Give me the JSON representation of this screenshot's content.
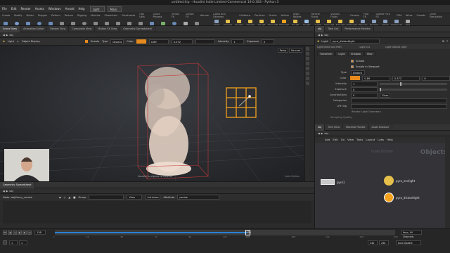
{
  "window": {
    "title": "untitled.hip - Houdini Indie Limited-Commercial 19.0.383 - Python 3"
  },
  "menu": {
    "items": [
      "File",
      "Edit",
      "Render",
      "Assets",
      "Windows",
      "Arnold",
      "Help"
    ],
    "desktop": "Light",
    "build_label": "Main"
  },
  "shelf": {
    "tabs": [
      "Create",
      "Modify",
      "Model",
      "Polygon",
      "Deform",
      "Texture",
      "Rigging",
      "Muscles",
      "Characters",
      "Constraints",
      "Hair Utils",
      "Guide Process",
      "Terrain FX",
      "Simple FX",
      "Volume"
    ],
    "right_tabs": [
      "Lights and Cameras",
      "Collisions",
      "Particles",
      "Grains",
      "Vellum",
      "Rigid Bodies",
      "Particle Fluids",
      "Viscous Fluids",
      "Oceans",
      "Pyro FX",
      "Sparse Pyro FX",
      "FEM",
      "Wires",
      "Crowds",
      "Drive Simulation"
    ],
    "tools": [
      "Camera",
      "Point Light",
      "Spot Light",
      "Area Light",
      "Geo Light",
      "Volume Light",
      "Distant Light",
      "Env Light",
      "Sky Light",
      "GI Light",
      "Caustic Light",
      "Portal Light",
      "Ambient Light",
      "Stereo Cam",
      "VR Camera",
      "Switcher",
      "Gamepad Cam",
      "Cloud"
    ]
  },
  "viewer": {
    "tabs": [
      "Scene View",
      "Animation Editor",
      "Render View",
      "Composite View",
      "Motion FX View",
      "Geometry Spreadsheet"
    ],
    "path": "obj",
    "toolbar": {
      "name": "Light",
      "mode": "Object Display",
      "enable_label": "Enable",
      "type_label": "Type",
      "type_value": "Distant",
      "color_label": "Color",
      "color_value": "0.89",
      "color_g": "0.372",
      "intensity_label": "Intensity",
      "intensity_value": "1",
      "exposure_label": "Exposure",
      "exposure_value": "0"
    },
    "camera": "Persp",
    "cam_menu": "No cam",
    "status": "Houdini is aligned to Objects",
    "badge": "Indie Edition"
  },
  "params": {
    "tabs": [
      "obj",
      "Take List",
      "Performance Monitor"
    ],
    "path": "obj",
    "node_type": "Light",
    "node_name": "pyro_distantlight",
    "header_left": "Light Name and Path",
    "header_mid": "Light 2.0",
    "header_right": "Light Distant Light",
    "ptabs": [
      "Transform",
      "Light",
      "Shadow",
      "Misc"
    ],
    "enable_label": "Enable",
    "viewport_label": "Enable in Viewport",
    "type_label": "Type",
    "type_value": "Distant",
    "color_label": "Color",
    "color_r": "0.89",
    "color_g": "0.372",
    "color_b": "0",
    "intensity_label": "Intensity",
    "intensity_value": "1",
    "exposure_label": "Exposure",
    "exposure_value": "0",
    "contributions_label": "Contributions",
    "contributions_value": "0",
    "contributions_btn": "Clear",
    "categories_label": "Categories",
    "lpe_label": "LPE Tag",
    "section": "Render Light Geometry",
    "bottom": "Sampling Quality"
  },
  "network": {
    "tabs": [
      "obj",
      "Tree View",
      "Material Palette",
      "Asset Browser"
    ],
    "path": "obj",
    "menu": [
      "Add",
      "Edit",
      "Go",
      "View",
      "Tools",
      "Layout",
      "Labs",
      "Help"
    ],
    "watermark": "Indie Edition",
    "context": "Objects",
    "nodes": [
      {
        "name": "pyro1",
        "kind": "geo"
      },
      {
        "name": "pyro_envlight",
        "kind": "envlight",
        "sub": "Light"
      },
      {
        "name": "pyro_distantlight",
        "kind": "distant",
        "sub": "Light"
      }
    ]
  },
  "spreadsheet": {
    "tabs": [
      "Geometry Spreadsheet"
    ],
    "path": "obj",
    "node_label": "Node: obj/fancy_smoke",
    "group_label": "Group",
    "view_label": "View",
    "intrinsics": "Intrinsics",
    "attribute_label": "Attribute",
    "attribute_value": "pscale"
  },
  "timeline": {
    "frame": "136",
    "start": "1",
    "end": "240",
    "end2": "240",
    "ticks": [
      "1",
      "24",
      "48",
      "72",
      "96",
      "120",
      "136",
      "168",
      "192",
      "216",
      "240"
    ],
    "progress": 0.567,
    "keys_label": "Keys, All Channels",
    "auto_label": "Auto Update"
  },
  "colors": {
    "accent": "#e68a1e",
    "timeline": "#2a7fd4",
    "bbox": "#c83a3a",
    "light": "#f5a21c"
  }
}
